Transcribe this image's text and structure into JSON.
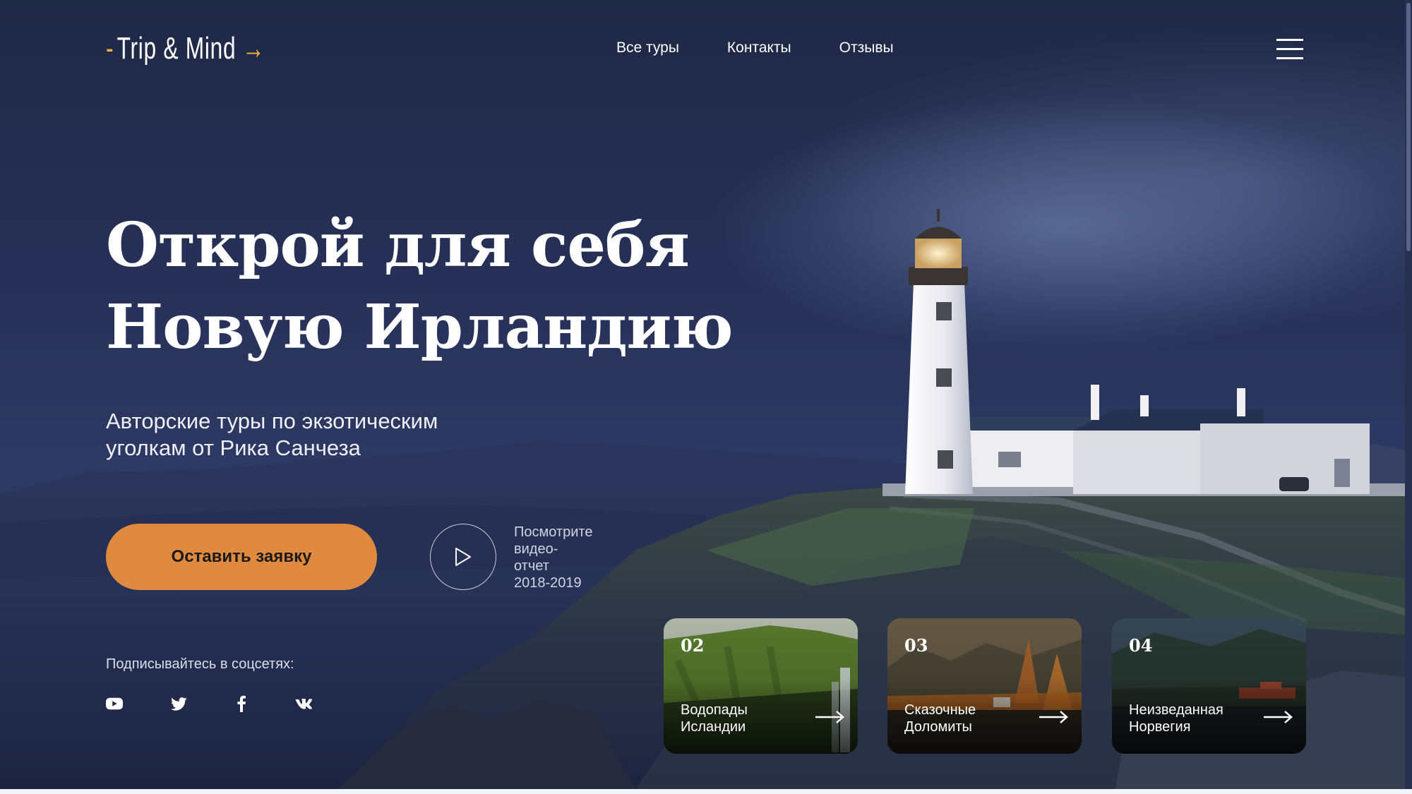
{
  "header": {
    "logo": {
      "dash": "-",
      "text": "Trip & Mind",
      "arrow": "→"
    },
    "nav": [
      {
        "label": "Все туры"
      },
      {
        "label": "Контакты"
      },
      {
        "label": "Отзывы"
      }
    ],
    "menu_icon": "hamburger-menu-icon"
  },
  "hero": {
    "headline_line1": "Открой для себя",
    "headline_line2": "Новую Ирландию",
    "subtitle_line1": "Авторские туры по экзотическим",
    "subtitle_line2": "уголкам от Рика Санчеза",
    "cta_label": "Оставить заявку",
    "video_caption_lines": [
      "Посмотрите",
      "видео-",
      "отчет",
      "2018-2019"
    ]
  },
  "social": {
    "label": "Подписывайтесь в соцсетях:",
    "icons": [
      "youtube-icon",
      "twitter-icon",
      "facebook-icon",
      "vk-icon"
    ]
  },
  "tours": [
    {
      "num": "02",
      "title_line1": "Водопады",
      "title_line2": "Исландии"
    },
    {
      "num": "03",
      "title_line1": "Сказочные",
      "title_line2": "Доломиты"
    },
    {
      "num": "04",
      "title_line1": "Неизведанная",
      "title_line2": "Норвегия"
    }
  ],
  "colors": {
    "accent": "#f0b43c",
    "cta": "#e08a40",
    "background": "#1f2845"
  }
}
